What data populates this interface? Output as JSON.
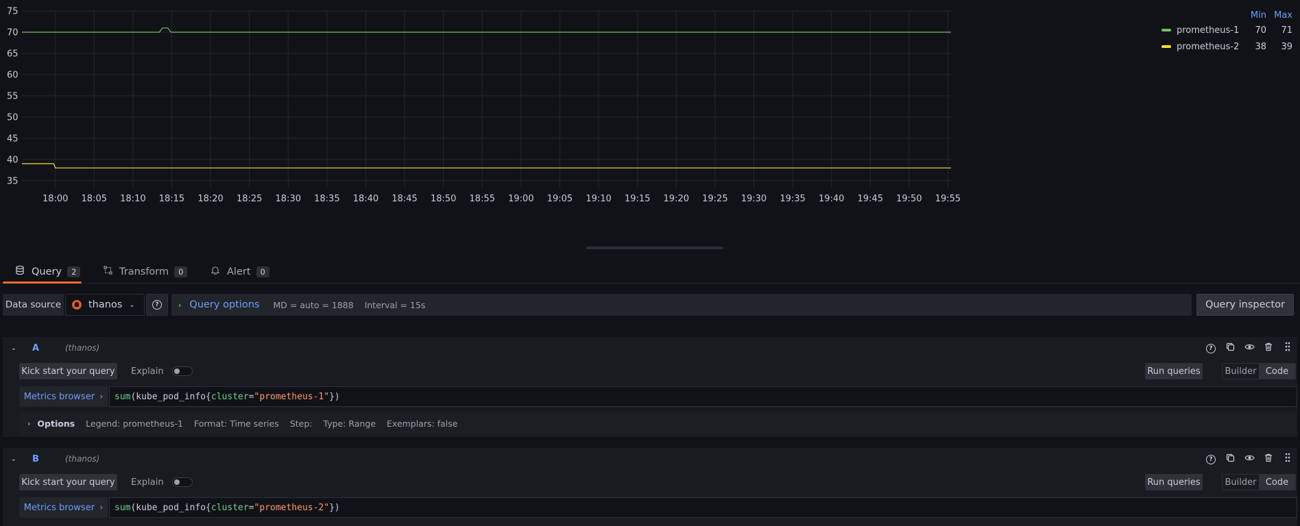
{
  "chart_data": {
    "type": "line",
    "y_ticks": [
      75,
      70,
      65,
      60,
      55,
      50,
      45,
      40,
      35
    ],
    "ylim": [
      34,
      75
    ],
    "x_ticks": [
      "18:00",
      "18:05",
      "18:10",
      "18:15",
      "18:20",
      "18:25",
      "18:30",
      "18:35",
      "18:40",
      "18:45",
      "18:50",
      "18:55",
      "19:00",
      "19:05",
      "19:10",
      "19:15",
      "19:20",
      "19:25",
      "19:30",
      "19:35",
      "19:40",
      "19:45",
      "19:50",
      "19:55"
    ],
    "x_range_min": [
      -4.3,
      115.4
    ],
    "grid": true,
    "legend_position": "right",
    "legend_headers": [
      "Min",
      "Max"
    ],
    "series": [
      {
        "name": "prometheus-1",
        "color": "#73bf69",
        "min": "70",
        "max": "71",
        "points": [
          [
            -4.3,
            70
          ],
          [
            13.4,
            70
          ],
          [
            13.8,
            71
          ],
          [
            14.5,
            71
          ],
          [
            14.9,
            70
          ],
          [
            115.4,
            70
          ]
        ]
      },
      {
        "name": "prometheus-2",
        "color": "#fade2a",
        "min": "38",
        "max": "39",
        "points": [
          [
            -4.3,
            39
          ],
          [
            -0.2,
            39
          ],
          [
            0.0,
            38
          ],
          [
            115.4,
            38
          ]
        ]
      }
    ]
  },
  "tabs": [
    {
      "label": "Query",
      "count": "2",
      "icon": "database-icon"
    },
    {
      "label": "Transform",
      "count": "0",
      "icon": "transform-icon"
    },
    {
      "label": "Alert",
      "count": "0",
      "icon": "bell-icon"
    }
  ],
  "datasource": {
    "label": "Data source",
    "name": "thanos",
    "query_options_title": "Query options",
    "md": "MD = auto = 1888",
    "interval": "Interval = 15s",
    "inspector": "Query inspector"
  },
  "queries": [
    {
      "ref": "A",
      "ds": "(thanos)",
      "kick": "Kick start your query",
      "explain": "Explain",
      "run": "Run queries",
      "builder": "Builder",
      "code_label": "Code",
      "metrics_browser": "Metrics browser",
      "expr": {
        "fn": "sum",
        "p1": "(kube_pod_info{",
        "label": "cluster",
        "eq": "=",
        "value": "\"prometheus-1\"",
        "p2": "})"
      },
      "options_title": "Options",
      "options": [
        "Legend: prometheus-1",
        "Format: Time series",
        "Step:",
        "Type: Range",
        "Exemplars: false"
      ]
    },
    {
      "ref": "B",
      "ds": "(thanos)",
      "kick": "Kick start your query",
      "explain": "Explain",
      "run": "Run queries",
      "builder": "Builder",
      "code_label": "Code",
      "metrics_browser": "Metrics browser",
      "expr": {
        "fn": "sum",
        "p1": "(kube_pod_info{",
        "label": "cluster",
        "eq": "=",
        "value": "\"prometheus-2\"",
        "p2": "})"
      }
    }
  ]
}
